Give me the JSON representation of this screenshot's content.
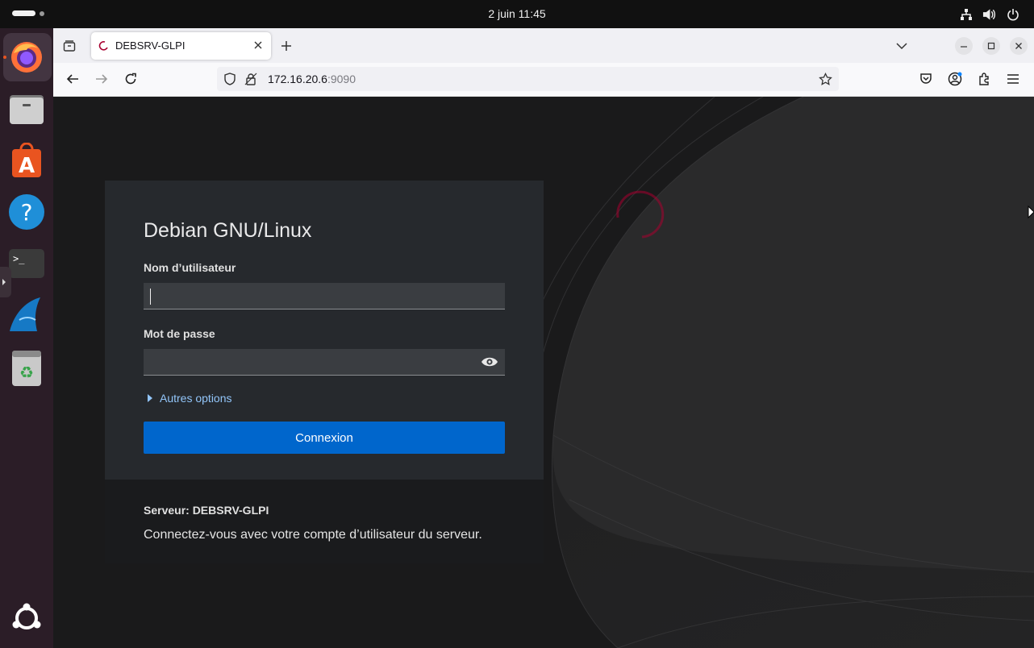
{
  "system": {
    "clock": "2 juin  11:45"
  },
  "browser": {
    "tab_title": "DEBSRV-GLPI",
    "url_host": "172.16.20.6",
    "url_port": ":9090"
  },
  "login": {
    "brand": "Debian GNU/Linux",
    "username_label": "Nom d’utilisateur",
    "username_value": "",
    "password_label": "Mot de passe",
    "password_value": "",
    "other_options": "Autres options",
    "submit": "Connexion",
    "server_line": "Serveur: DEBSRV-GLPI",
    "hint": "Connectez-vous avec votre compte d’utilisateur du serveur."
  },
  "colors": {
    "accent": "#0066cc",
    "link": "#92c5f9",
    "debian_red": "#a80030"
  }
}
